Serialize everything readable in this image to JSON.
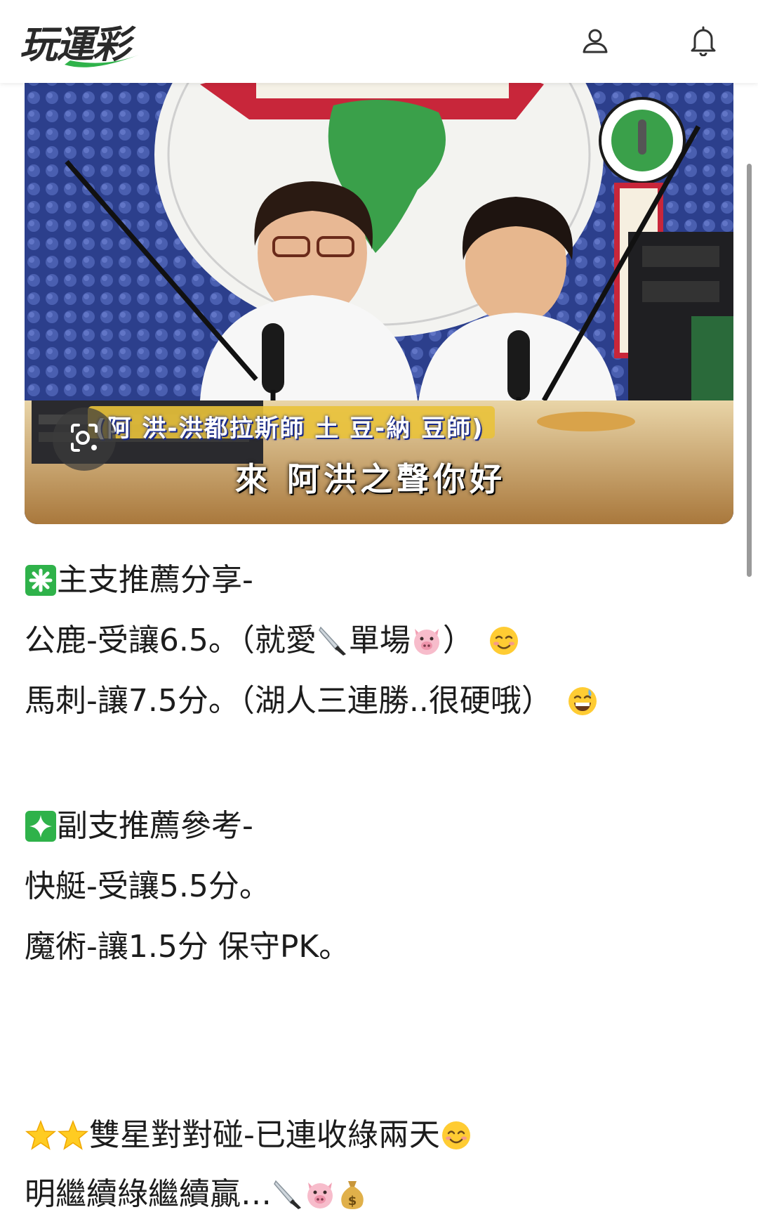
{
  "header": {
    "logo_text": "玩運彩",
    "profile_icon": "user-icon",
    "notifications_icon": "bell-icon"
  },
  "image": {
    "caption": "來 阿洪之聲你好",
    "names_bar": "(阿 洪-洪都拉斯師 土 豆-納 豆師)",
    "lens_icon": "lens-search-icon"
  },
  "post": {
    "main_pick": {
      "heading": "主支推薦分享-",
      "heading_icon": "green-asterisk-icon",
      "lines": [
        {
          "text_a": "公鹿-受讓6.5。（就愛",
          "icon_1": "knife-icon",
          "text_b": "單場",
          "icon_2": "pig-icon",
          "text_c": "）",
          "icon_3": "smiling-face-icon"
        },
        {
          "text_a": "馬刺-讓7.5分。（湖人三連勝..很硬哦）",
          "icon_1": "grinning-sweat-icon"
        }
      ]
    },
    "sub_pick": {
      "heading": "副支推薦參考-",
      "heading_icon": "green-sparkle-icon",
      "lines": [
        {
          "text": "快艇-受讓5.5分。"
        },
        {
          "text": "魔術-讓1.5分 保守PK。"
        }
      ]
    },
    "double_star": {
      "heading": "雙星對對碰-已連收綠兩天",
      "heading_icons": [
        "star-icon",
        "star-icon",
        "smiling-eyes-icon"
      ],
      "line": {
        "text": "明繼續綠繼續贏…",
        "icons": [
          "knife-icon",
          "pig-icon",
          "money-bag-icon"
        ]
      }
    }
  },
  "colors": {
    "accent_green": "#2fb24a",
    "text": "#1c1c1c",
    "header_bg": "#ffffff"
  }
}
